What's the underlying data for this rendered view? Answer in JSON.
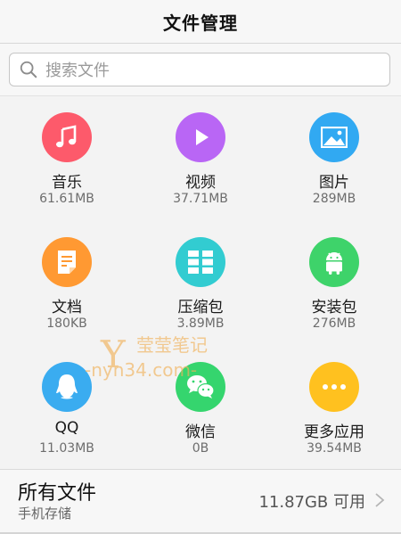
{
  "header": {
    "title": "文件管理"
  },
  "search": {
    "placeholder": "搜索文件"
  },
  "categories": [
    {
      "label": "音乐",
      "size": "61.61MB",
      "icon": "music-note-icon",
      "color": "#fd5a6b"
    },
    {
      "label": "视频",
      "size": "37.71MB",
      "icon": "play-icon",
      "color": "#b966f5"
    },
    {
      "label": "图片",
      "size": "289MB",
      "icon": "image-icon",
      "color": "#31a9f2"
    },
    {
      "label": "文档",
      "size": "180KB",
      "icon": "document-icon",
      "color": "#ff9932"
    },
    {
      "label": "压缩包",
      "size": "3.89MB",
      "icon": "archive-icon",
      "color": "#32ccd1"
    },
    {
      "label": "安装包",
      "size": "276MB",
      "icon": "android-icon",
      "color": "#3ed36a"
    },
    {
      "label": "QQ",
      "size": "11.03MB",
      "icon": "qq-penguin-icon",
      "color": "#3aacf0"
    },
    {
      "label": "微信",
      "size": "0B",
      "icon": "wechat-icon",
      "color": "#35d56e"
    },
    {
      "label": "更多应用",
      "size": "39.54MB",
      "icon": "more-dots-icon",
      "color": "#ffc11f"
    }
  ],
  "watermark": {
    "text_cn": "莹莹笔记",
    "text_url": "-nyn34.com-",
    "text_y": "Y"
  },
  "storage": {
    "title": "所有文件",
    "subtitle": "手机存储",
    "free": "11.87GB 可用"
  }
}
